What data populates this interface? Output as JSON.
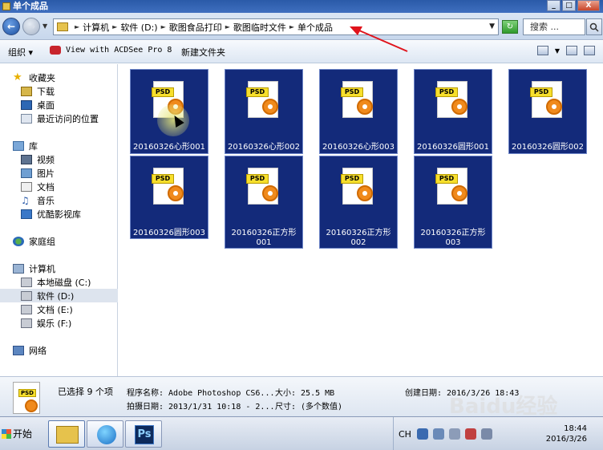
{
  "window": {
    "title": "单个成品",
    "min_label": "_",
    "max_label": "□",
    "close_label": "X"
  },
  "address": {
    "crumbs": [
      "计算机",
      "软件 (D:)",
      "歌图食品打印",
      "歌图临时文件",
      "单个成品"
    ],
    "search_placeholder": "搜索 ..."
  },
  "toolbar": {
    "organize": "组织 ▾",
    "acdsee": "View with ACDSee Pro 8",
    "new_folder": "新建文件夹"
  },
  "nav": {
    "favorites": "收藏夹",
    "downloads": "下载",
    "desktop": "桌面",
    "recent": "最近访问的位置",
    "libraries": "库",
    "videos": "视频",
    "pictures": "图片",
    "documents": "文档",
    "music": "音乐",
    "youku": "优酷影视库",
    "homegroup": "家庭组",
    "computer": "计算机",
    "drive_c": "本地磁盘 (C:)",
    "drive_d": "软件 (D:)",
    "drive_e": "文档 (E:)",
    "drive_f": "娱乐 (F:)",
    "network": "网络"
  },
  "files": [
    {
      "name": "20160326心形001"
    },
    {
      "name": "20160326心形002"
    },
    {
      "name": "20160326心形003"
    },
    {
      "name": "20160326圆形001"
    },
    {
      "name": "20160326圆形002"
    },
    {
      "name": "20160326圆形003"
    },
    {
      "name_l1": "20160326正方形",
      "name_l2": "001"
    },
    {
      "name_l1": "20160326正方形",
      "name_l2": "002"
    },
    {
      "name_l1": "20160326正方形",
      "name_l2": "003"
    }
  ],
  "psd_label": "PSD",
  "details": {
    "selected": "已选择 9 个项",
    "program": "程序名称: Adobe Photoshop CS6...",
    "size": "大小: 25.5 MB",
    "created": "创建日期: 2016/3/26 18:43",
    "taken": "拍摄日期: 2013/1/31 10:18 - 2...",
    "dimensions": "尺寸: (多个数值)"
  },
  "taskbar": {
    "start": "开始",
    "ps_label": "Ps",
    "ime": "CH",
    "time": "18:44",
    "date": "2016/3/26"
  },
  "watermark": "Baidu经验"
}
